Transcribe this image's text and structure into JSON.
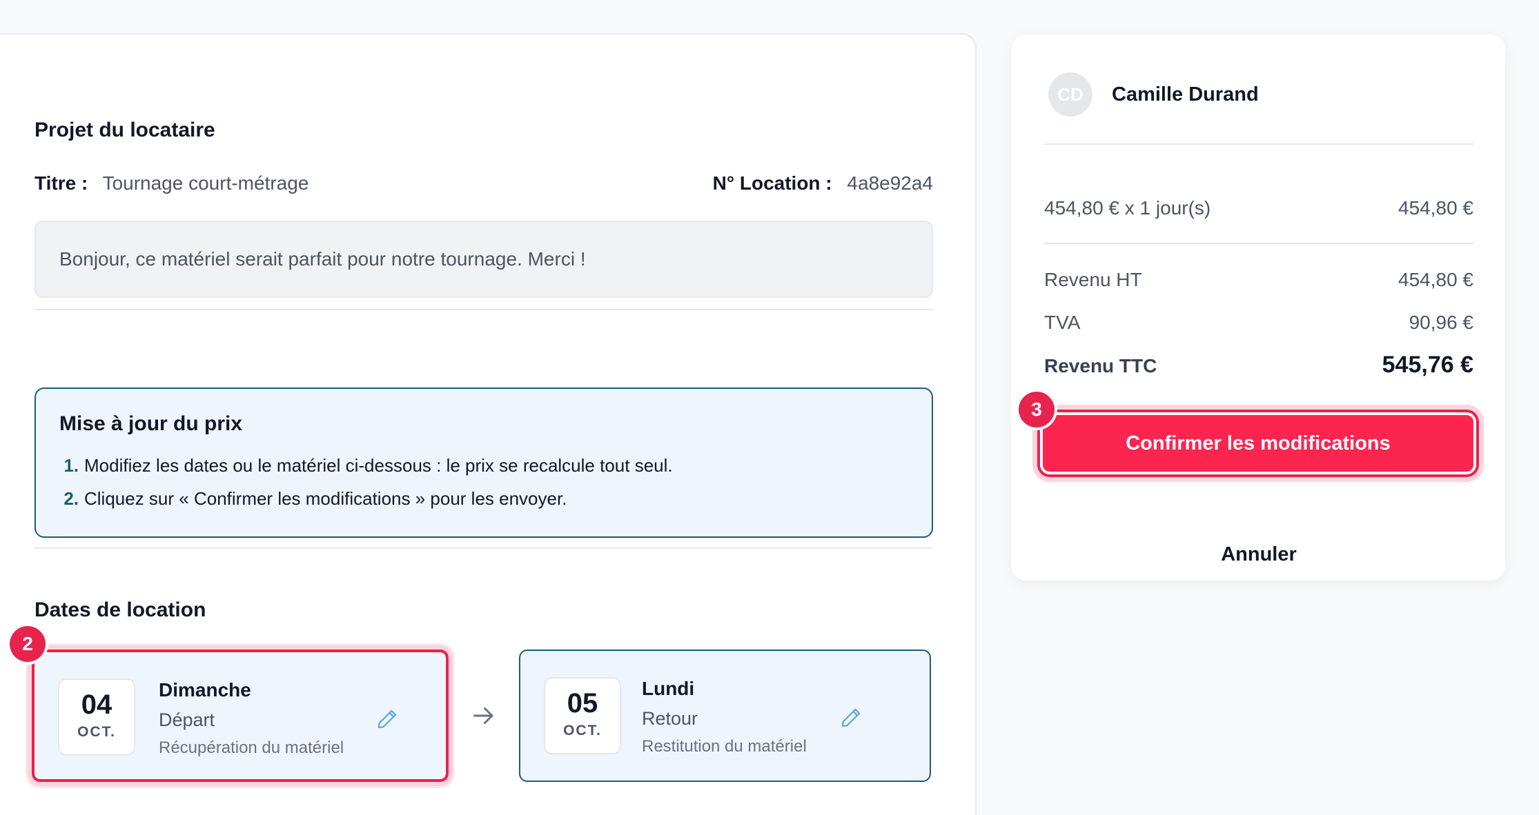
{
  "project": {
    "heading": "Projet du locataire",
    "title_label": "Titre :",
    "title_value": "Tournage court-métrage",
    "location_label": "N° Location :",
    "location_value": "4a8e92a4",
    "message": "Bonjour, ce matériel serait parfait pour notre tournage. Merci !"
  },
  "price_update": {
    "title": "Mise à jour du prix",
    "steps": [
      {
        "num": "1.",
        "text": "Modifiez les dates ou le matériel ci-dessous : le prix se recalcule tout seul."
      },
      {
        "num": "2.",
        "text": "Cliquez sur « Confirmer les modifications » pour les envoyer."
      }
    ]
  },
  "dates": {
    "heading": "Dates de location",
    "badge": "2",
    "start": {
      "day": "04",
      "month": "OCT.",
      "weekday": "Dimanche",
      "kind": "Départ",
      "desc": "Récupération du matériel"
    },
    "end": {
      "day": "05",
      "month": "OCT.",
      "weekday": "Lundi",
      "kind": "Retour",
      "desc": "Restitution du matériel"
    }
  },
  "summary": {
    "avatar_initials": "CD",
    "user_name": "Camille Durand",
    "line_label": "454,80 € x 1 jour(s)",
    "line_value": "454,80 €",
    "revenue_ht_label": "Revenu HT",
    "revenue_ht_value": "454,80 €",
    "tva_label": "TVA",
    "tva_value": "90,96 €",
    "revenue_ttc_label": "Revenu TTC",
    "revenue_ttc_value": "545,76 €",
    "badge": "3",
    "confirm_label": "Confirmer les modifications",
    "cancel_label": "Annuler"
  },
  "colors": {
    "accent_red": "#fb2550",
    "accent_blue": "#1e5a7a",
    "info_bg": "#eff5fc"
  },
  "icons": {
    "edit": "pencil-icon",
    "arrow": "arrow-right-icon"
  }
}
